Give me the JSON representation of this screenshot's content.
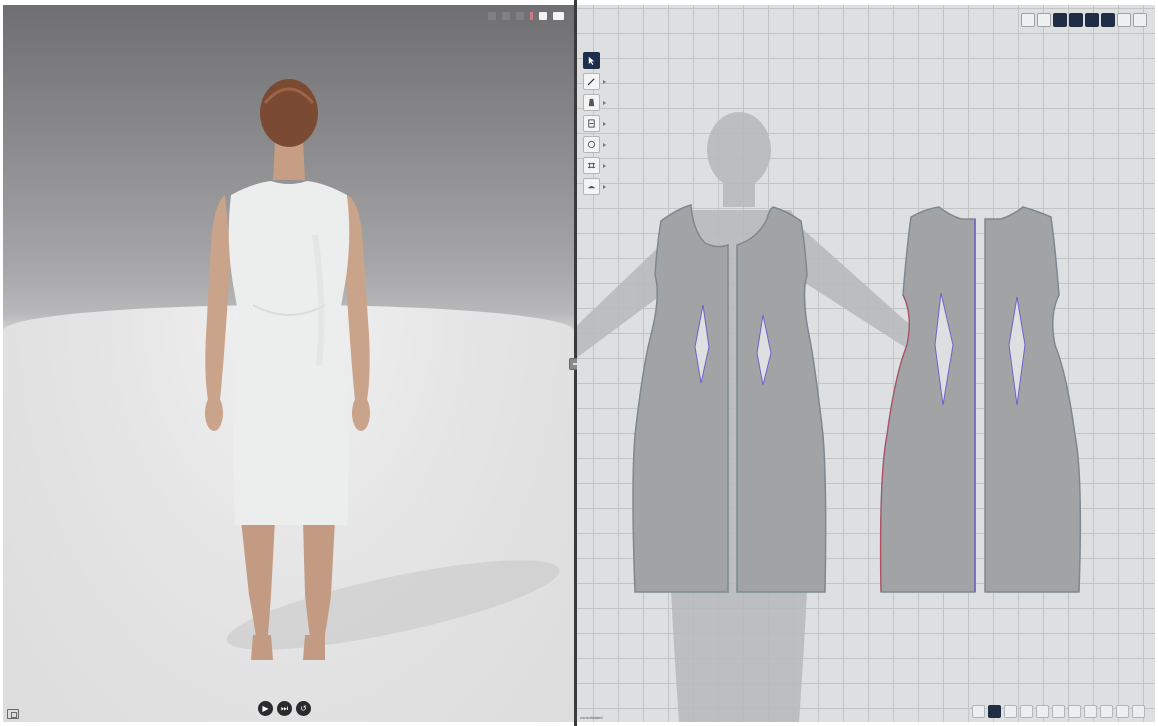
{
  "app": {
    "split_handle_icon": "split-view-handle-icon"
  },
  "view3d": {
    "top_icons": [
      "faint",
      "faint",
      "faint",
      "red",
      "white",
      "white-wide"
    ],
    "playback": [
      {
        "name": "play-icon",
        "glyph": "▶"
      },
      {
        "name": "next-frame-icon",
        "glyph": "⏭"
      },
      {
        "name": "reset-icon",
        "glyph": "↺"
      }
    ],
    "corner_icon": "view-mode-icon"
  },
  "view2d": {
    "tools": [
      {
        "name": "select-tool",
        "active": true
      },
      {
        "name": "pen-tool",
        "active": false
      },
      {
        "name": "pattern-tool",
        "active": false
      },
      {
        "name": "edit-point-tool",
        "active": false
      },
      {
        "name": "circle-tool",
        "active": false
      },
      {
        "name": "sewing-tool",
        "active": false
      },
      {
        "name": "fold-tool",
        "active": false
      }
    ],
    "top_buttons": [
      "light",
      "light",
      "dark",
      "dark",
      "dark",
      "dark",
      "light",
      "light"
    ],
    "bottom_buttons": [
      "light",
      "dark",
      "light",
      "light",
      "light",
      "light",
      "light",
      "light",
      "light",
      "light",
      "light"
    ],
    "status_text": "consolidated"
  },
  "colors": {
    "grid_bg": "#dedfe0",
    "pattern_fill": "#a2a3a5",
    "pattern_stroke": "#7d8891",
    "sewing_line": "#6f63c9",
    "active_tool": "#1d2f4a"
  }
}
